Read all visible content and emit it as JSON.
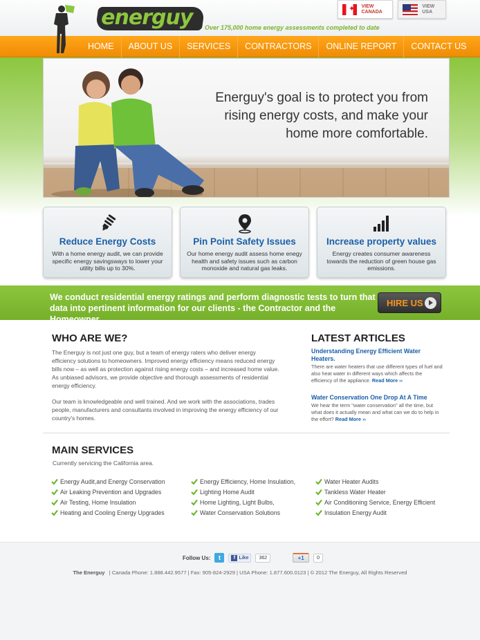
{
  "header": {
    "logo_text": "energuy",
    "tagline": "Over 175,000 home energy assessments completed to date",
    "view_canada": "VIEW CANADA",
    "view_usa": "VIEW USA"
  },
  "nav": {
    "items": [
      "HOME",
      "ABOUT US",
      "SERVICES",
      "CONTRACTORS",
      "ONLINE REPORT",
      "CONTACT US"
    ]
  },
  "hero": {
    "headline": "Energuy's goal is to protect you from rising energy costs, and make your home more comfortable."
  },
  "features": [
    {
      "icon": "light-bulb-icon",
      "title": "Reduce Energy Costs",
      "text": "With a home energy audit, we can provide specific energy savingsways to lower your utility bills up to 30%."
    },
    {
      "icon": "map-pin-icon",
      "title": "Pin Point Safety Issues",
      "text": "Our home energy audit assess home enegy health and safety issues such as carbon monoxide and natural gas leaks."
    },
    {
      "icon": "signal-bars-icon",
      "title": "Increase property values",
      "text": "Energy creates consumer awareness towards the reduction of green house gas emissions."
    }
  ],
  "banner": {
    "text": "We conduct residential energy ratings and perform diagnostic tests to turn that data into pertinent information for our clients - the Contractor and the Homeowner.",
    "button": "HIRE US"
  },
  "who": {
    "title": "WHO ARE WE?",
    "p1": "The Energuy is not just one guy, but a team of energy raters who deliver energy efficiency solutions to homeowners. Improved energy efficiency means reduced energy bills now – as well as protection against rising energy costs – and increased home value. As unbiased advisors, we provide objective and thorough assessments of residential energy efficiency.",
    "p2": "Our team is knowledgeable and well trained. And we work with the associations, trades people, manufacturers and consultants involved in improving the energy efficiency of our country's homes."
  },
  "articles": {
    "title": "LATEST ARTICLES",
    "items": [
      {
        "title": "Understanding Energy Efficient Water Heaters.",
        "body": "There are water heaters that use different types of fuel and also heat water in different ways which affects the efficiency of the appliance.",
        "more": "Read More ››"
      },
      {
        "title": "Water Conservation One Drop At A Time",
        "body": "We hear the term \"water conservation\" all the time, but what does it actually mean and what can we do to help in the effort?",
        "more": "Read More ››"
      }
    ]
  },
  "services": {
    "title": "MAIN SERVICES",
    "subtitle": "Currently servicing the California area.",
    "col1": [
      "Energy Audit,and Energy Conservation",
      "Air Leaking Prevention and Upgrades",
      "Air Testing, Home Insulation",
      "Heating and Cooling Energy Upgrades"
    ],
    "col2": [
      "Energy Efficiency, Home Insulation,",
      "Lighting Home Audit",
      "Home Lighting, Light Bulbs,",
      "Water Conservation Solutions"
    ],
    "col3": [
      "Water Heater Audits",
      "Tankless Water Heater",
      "Air Conditioning Service, Energy Efficient",
      "Insulation Energy Audit"
    ]
  },
  "footer": {
    "follow_label": "Follow Us:",
    "twitter": "t",
    "fb_like": "Like",
    "fb_count": "362",
    "gplus": "+1",
    "gplus_count": "0",
    "brand": "The Energuy",
    "line": "|   Canada Phone: 1.888.442.9577   |   Fax: 905-824-2929   |   USA Phone: 1.877.600.0123   |   © 2012 The Energuy, All Rights Reserved"
  },
  "colors": {
    "orange": "#f7941d",
    "green": "#8cc63f",
    "blue": "#1b5fa8"
  }
}
